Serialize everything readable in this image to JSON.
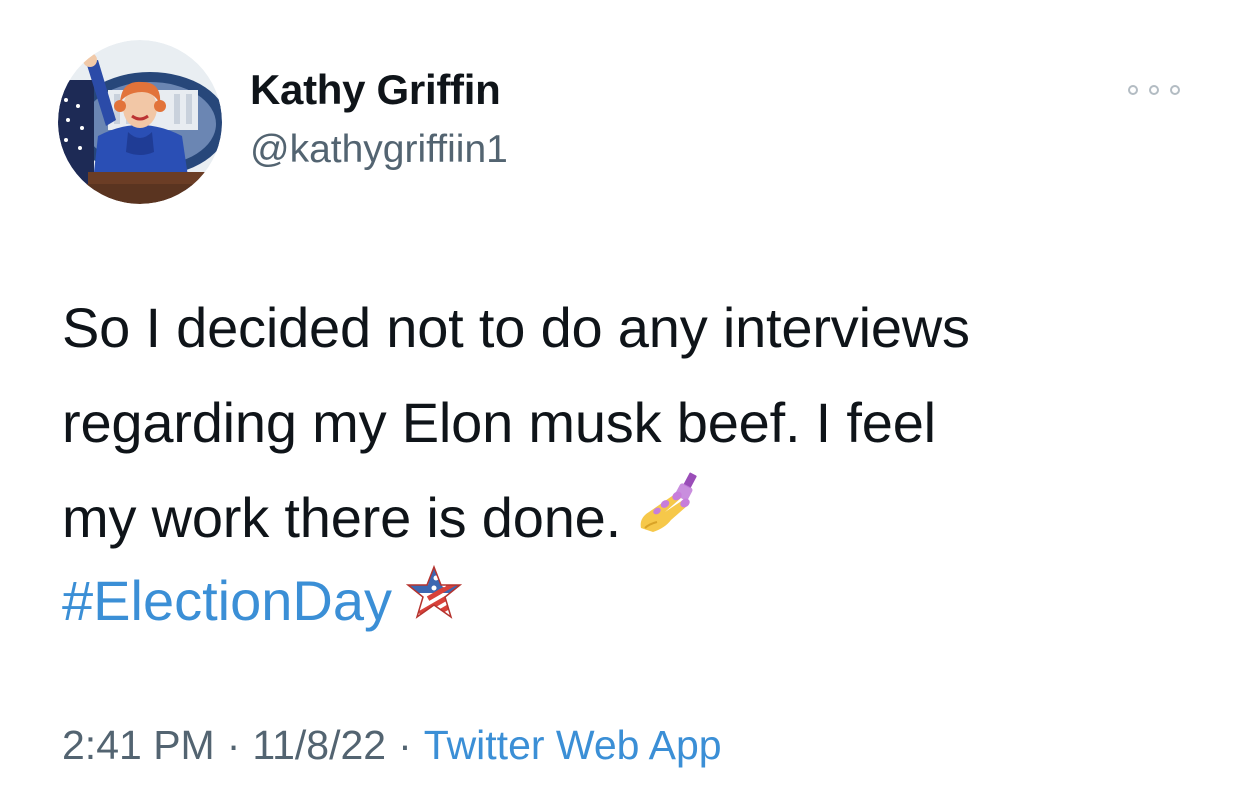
{
  "author": {
    "name": "Kathy Griffin",
    "handle": "@kathygriffiin1"
  },
  "tweet": {
    "text_lines": [
      "So I decided not to do any interviews",
      "regarding my Elon musk beef. I feel",
      "my work there is done."
    ],
    "text_emoji": "nail-polish-emoji",
    "hashtag": "#ElectionDay",
    "hashtag_emoji": "us-flag-star-emoji"
  },
  "meta": {
    "time": "2:41 PM",
    "separator": "·",
    "date": "11/8/22",
    "source": "Twitter Web App"
  },
  "icons": {
    "more": "more-options-icon"
  },
  "colors": {
    "link": "#3b8fd6",
    "secondary_text": "#536471",
    "primary_text": "#0f1419"
  }
}
